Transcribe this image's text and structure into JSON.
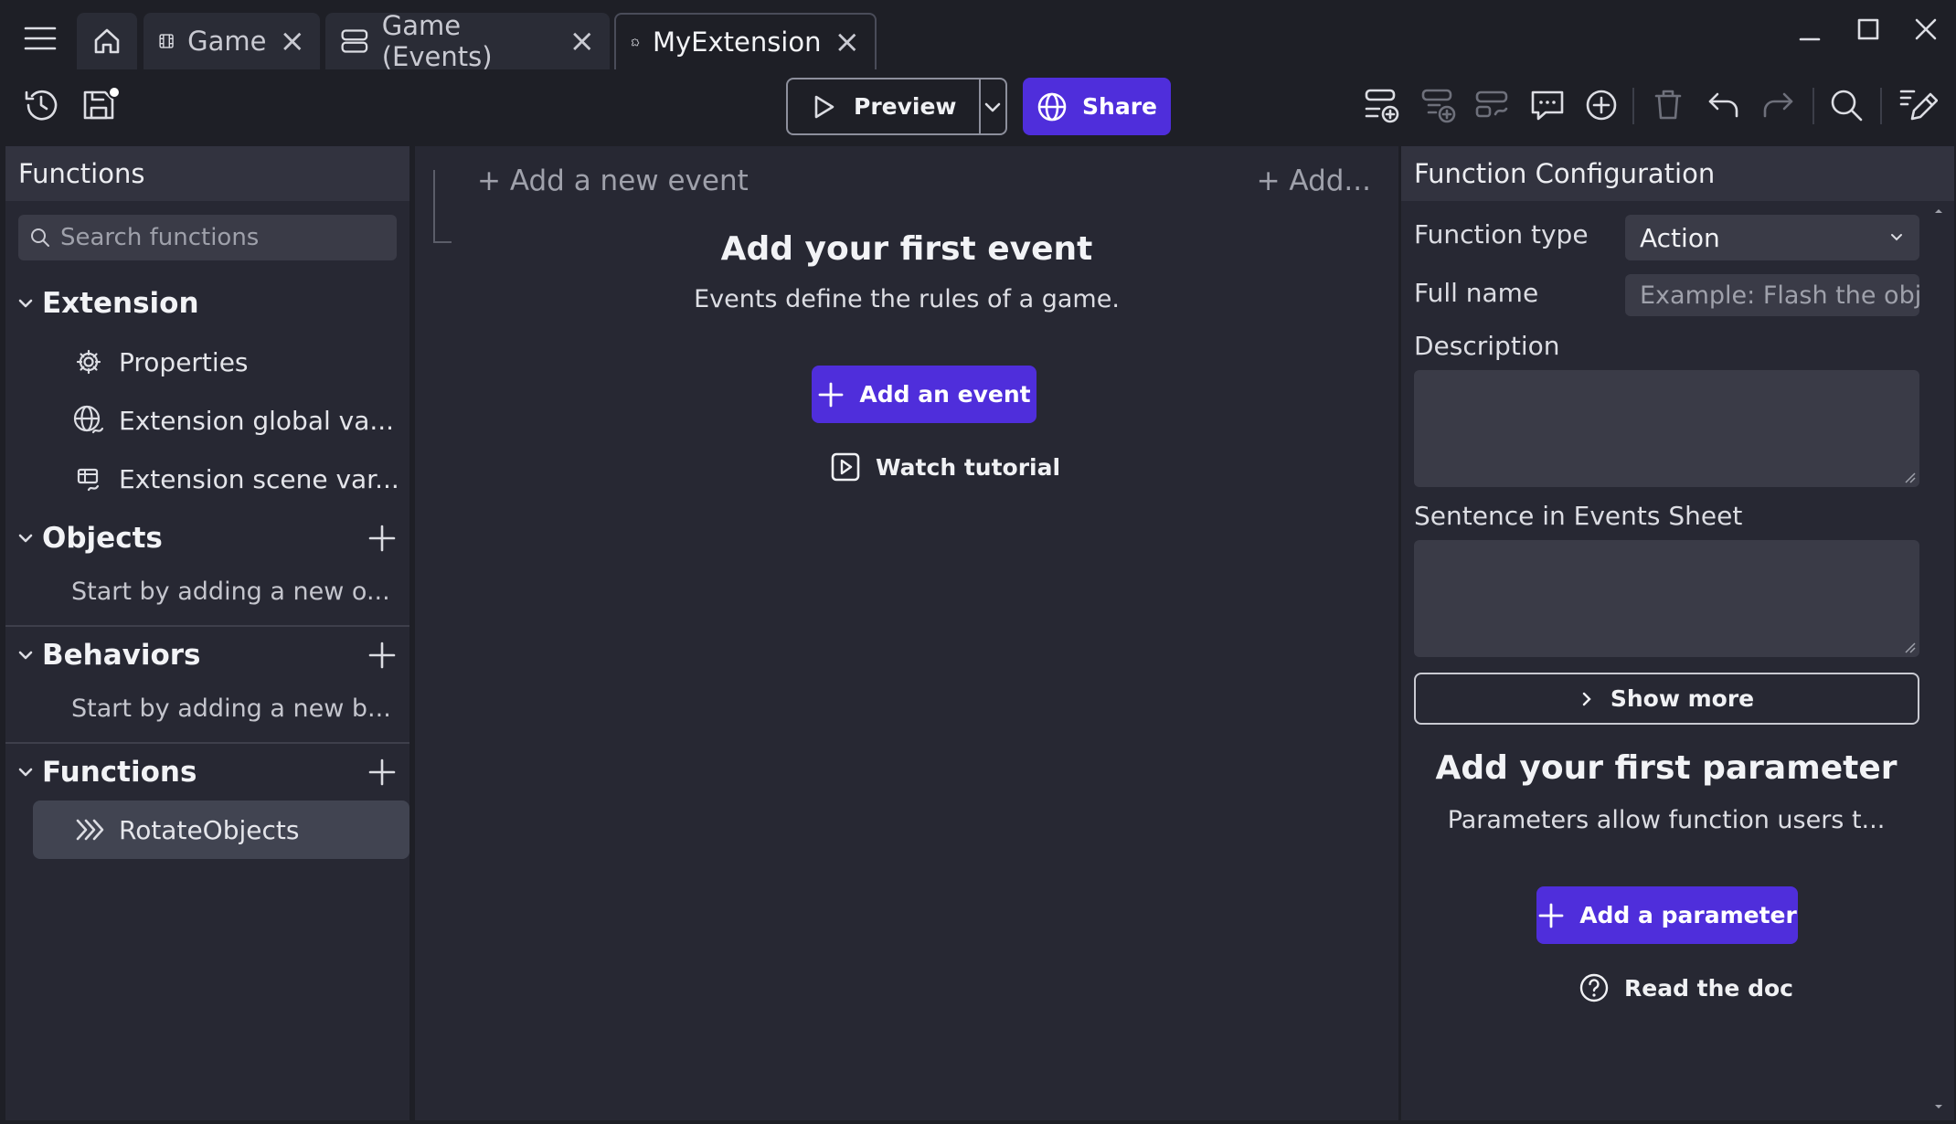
{
  "tabs": [
    {
      "label": "Game",
      "icon": "film-icon",
      "closable": true
    },
    {
      "label": "Game (Events)",
      "icon": "events-icon",
      "closable": true
    },
    {
      "label": "MyExtension",
      "icon": "puzzle-icon",
      "closable": true,
      "active": true
    }
  ],
  "toolbar": {
    "preview_label": "Preview",
    "share_label": "Share"
  },
  "left_panel": {
    "title": "Functions",
    "search_placeholder": "Search functions",
    "extension": {
      "title": "Extension",
      "items": [
        {
          "label": "Properties",
          "icon": "gear-icon"
        },
        {
          "label": "Extension global va...",
          "icon": "globe-icon"
        },
        {
          "label": "Extension scene var...",
          "icon": "scene-variables-icon"
        }
      ]
    },
    "objects": {
      "title": "Objects",
      "hint": "Start by adding a new o..."
    },
    "behaviors": {
      "title": "Behaviors",
      "hint": "Start by adding a new b..."
    },
    "functions": {
      "title": "Functions",
      "items": [
        {
          "label": "RotateObjects",
          "icon": "function-icon",
          "selected": true
        }
      ]
    }
  },
  "events_sheet": {
    "add_new_event": "+ Add a new event",
    "add_more": "+ Add...",
    "empty_title": "Add your first event",
    "empty_subtitle": "Events define the rules of a game.",
    "add_event_button": "Add an event",
    "watch_tutorial": "Watch tutorial"
  },
  "right_panel": {
    "title": "Function Configuration",
    "function_type_label": "Function type",
    "function_type_value": "Action",
    "full_name_label": "Full name",
    "full_name_placeholder": "Example: Flash the obje",
    "description_label": "Description",
    "sentence_label": "Sentence in Events Sheet",
    "show_more": "Show more",
    "param_title": "Add your first parameter",
    "param_subtitle": "Parameters allow function users t...",
    "add_param_button": "Add a parameter",
    "read_doc": "Read the doc"
  },
  "colors": {
    "accent": "#4f2edb",
    "background": "#1e1f26",
    "panel": "#272833"
  }
}
